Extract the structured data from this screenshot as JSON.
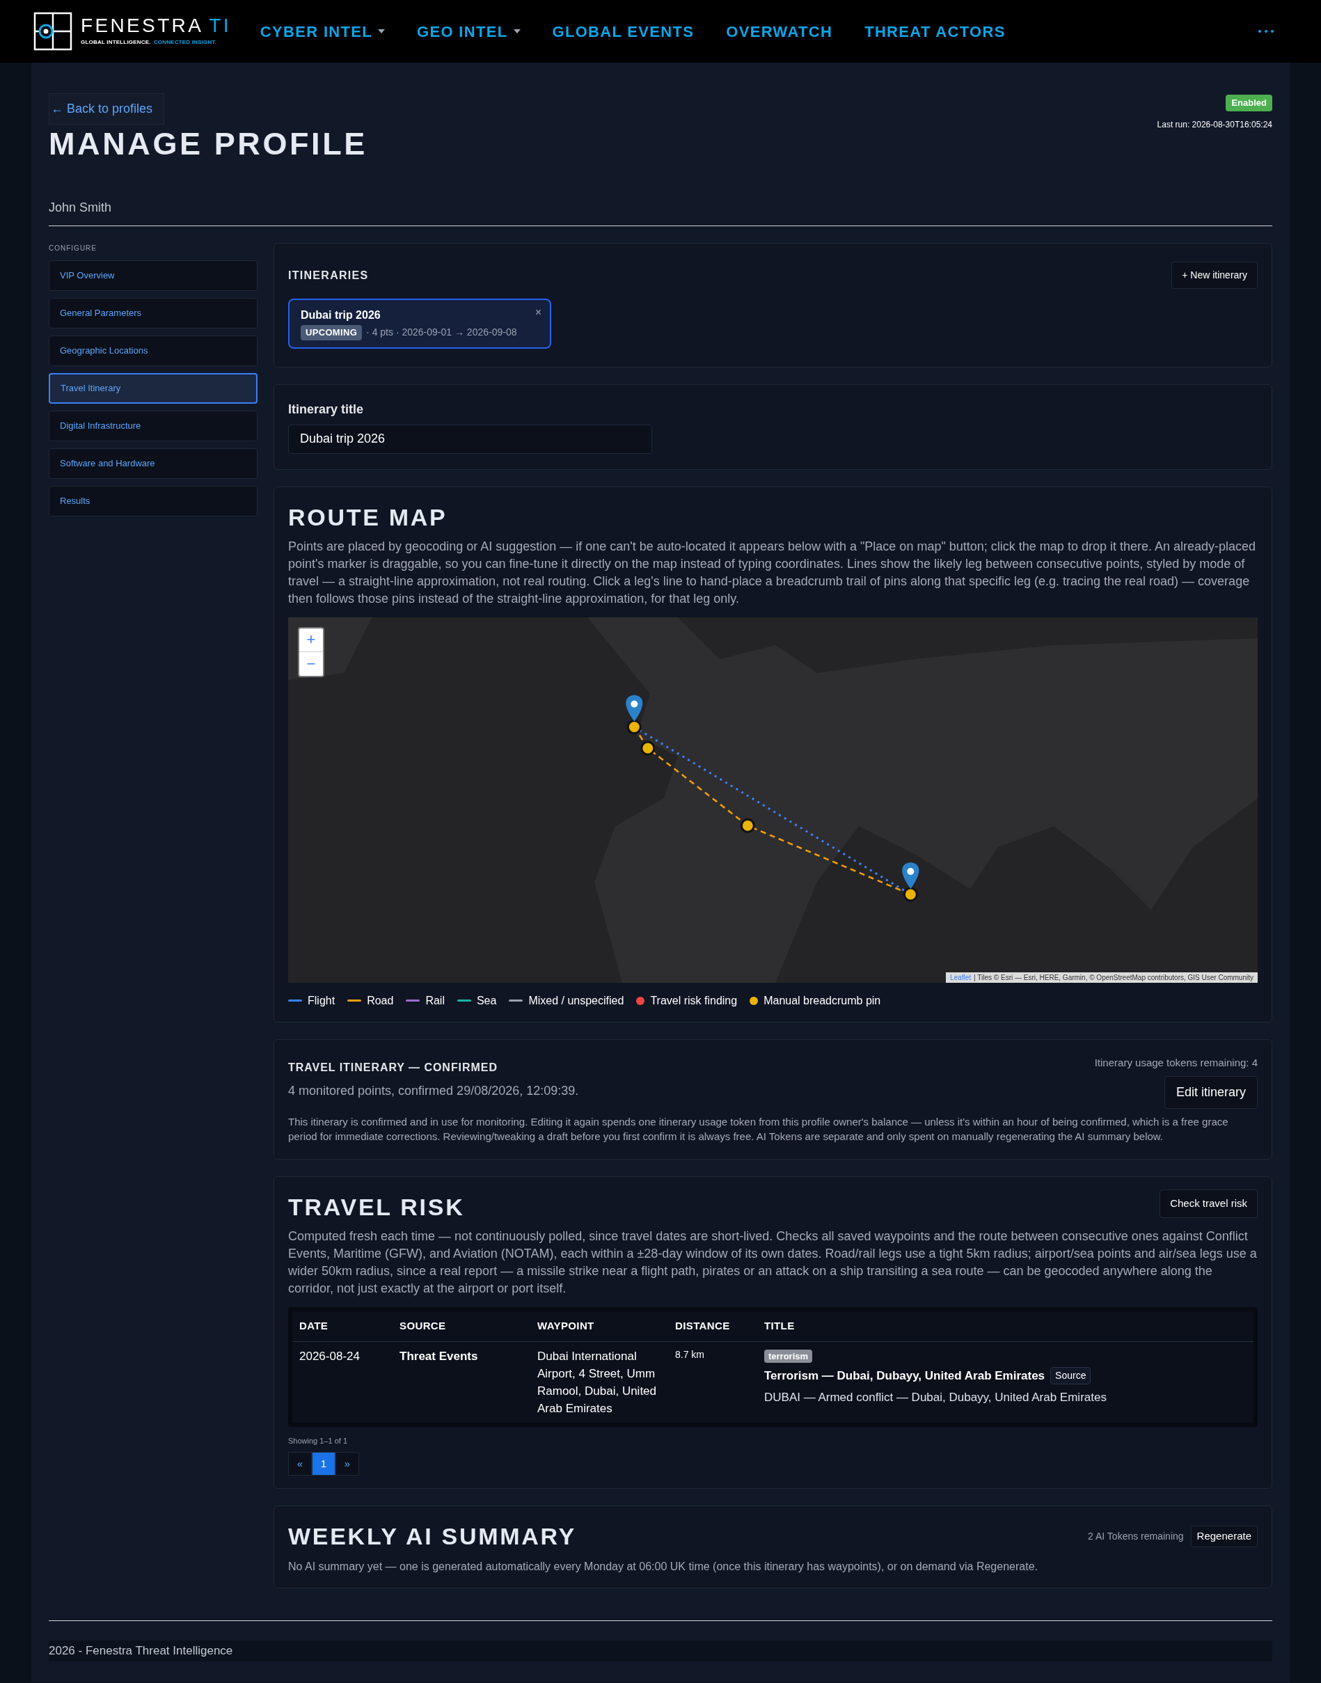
{
  "header": {
    "logo_title": "FENESTRA",
    "logo_accent": "TI",
    "logo_tagline": "GLOBAL INTELLIGENCE.",
    "logo_tagline_accent": "CONNECTED INSIGHT.",
    "nav": [
      {
        "label": "CYBER INTEL",
        "dropdown": true
      },
      {
        "label": "GEO INTEL",
        "dropdown": true
      },
      {
        "label": "GLOBAL EVENTS",
        "dropdown": false
      },
      {
        "label": "OVERWATCH",
        "dropdown": false
      },
      {
        "label": "THREAT ACTORS",
        "dropdown": false
      }
    ]
  },
  "page": {
    "back_link": "← Back to profiles",
    "title": "MANAGE PROFILE",
    "status_badge": "Enabled",
    "last_run": "Last run: 2026-08-30T16:05:24",
    "profile_name": "John Smith"
  },
  "sidebar": {
    "heading": "CONFIGURE",
    "items": [
      {
        "label": "VIP Overview",
        "selected": false
      },
      {
        "label": "General Parameters",
        "selected": false
      },
      {
        "label": "Geographic Locations",
        "selected": false
      },
      {
        "label": "Travel Itinerary",
        "selected": true
      },
      {
        "label": "Digital Infrastructure",
        "selected": false
      },
      {
        "label": "Software and Hardware",
        "selected": false
      },
      {
        "label": "Results",
        "selected": false
      }
    ]
  },
  "itineraries": {
    "heading": "ITINERARIES",
    "new_button": "+ New itinerary",
    "items": [
      {
        "title": "Dubai trip 2026",
        "status": "UPCOMING",
        "meta": "· 4 pts · 2026-09-01 → 2026-09-08",
        "close": "×",
        "selected": true
      }
    ]
  },
  "title_field": {
    "label": "Itinerary title",
    "value": "Dubai trip 2026"
  },
  "route_map": {
    "heading": "ROUTE MAP",
    "description": "Points are placed by geocoding or AI suggestion — if one can't be auto-located it appears below with a \"Place on map\" button; click the map to drop it there. An already-placed point's marker is draggable, so you can fine-tune it directly on the map instead of typing coordinates. Lines show the likely leg between consecutive points, styled by mode of travel — a straight-line approximation, not real routing. Click a leg's line to hand-place a breadcrumb trail of pins along that specific leg (e.g. tracing the real road) — coverage then follows those pins instead of the straight-line approximation, for that leg only.",
    "zoom_in": "+",
    "zoom_out": "−",
    "attribution_link": "Leaflet",
    "attribution": "| Tiles © Esri — Esri, HERE, Garmin, © OpenStreetMap contributors, GIS User Community",
    "legend": [
      {
        "kind": "line",
        "label": "Flight",
        "color": "#3b82f6"
      },
      {
        "kind": "line",
        "label": "Road",
        "color": "#f59e0b"
      },
      {
        "kind": "line",
        "label": "Rail",
        "color": "#a06cd5"
      },
      {
        "kind": "line",
        "label": "Sea",
        "color": "#14b8a6"
      },
      {
        "kind": "line",
        "label": "Mixed / unspecified",
        "color": "#9ca3af"
      },
      {
        "kind": "dot",
        "label": "Travel risk finding",
        "color": "#ef4444"
      },
      {
        "kind": "dot",
        "label": "Manual breadcrumb pin",
        "color": "#eab308"
      }
    ]
  },
  "confirmed": {
    "heading": "TRAVEL ITINERARY — CONFIRMED",
    "summary": "4 monitored points, confirmed 29/08/2026, 12:09:39.",
    "tokens": "Itinerary usage tokens remaining: 4",
    "edit_button": "Edit itinerary",
    "note": "This itinerary is confirmed and in use for monitoring. Editing it again spends one itinerary usage token from this profile owner's balance — unless it's within an hour of being confirmed, which is a free grace period for immediate corrections. Reviewing/tweaking a draft before you first confirm it is always free. AI Tokens are separate and only spent on manually regenerating the AI summary below."
  },
  "travel_risk": {
    "heading": "TRAVEL RISK",
    "check_button": "Check travel risk",
    "description": "Computed fresh each time — not continuously polled, since travel dates are short-lived. Checks all saved waypoints and the route between consecutive ones against Conflict Events, Maritime (GFW), and Aviation (NOTAM), each within a ±28-day window of its own dates. Road/rail legs use a tight 5km radius; airport/sea points and air/sea legs use a wider 50km radius, since a real report — a missile strike near a flight path, pirates or an attack on a ship transiting a sea route — can be geocoded anywhere along the corridor, not just exactly at the airport or port itself.",
    "table": {
      "columns": [
        "DATE",
        "SOURCE",
        "WAYPOINT",
        "DISTANCE",
        "TITLE"
      ],
      "rows": [
        {
          "date": "2026-08-24",
          "source": "Threat Events",
          "waypoint": "Dubai International Airport, 4 Street, Umm Ramool, Dubai, United Arab Emirates",
          "distance": "8.7 km",
          "tag": "terrorism",
          "title": "Terrorism — Dubai, Dubayy, United Arab Emirates",
          "source_button": "Source",
          "detail": "DUBAI — Armed conflict — Dubai, Dubayy, United Arab Emirates"
        }
      ]
    },
    "showing": "Showing 1–1 of 1",
    "pagination": [
      {
        "label": "«",
        "selected": false
      },
      {
        "label": "1",
        "selected": true
      },
      {
        "label": "»",
        "selected": false
      }
    ]
  },
  "weekly_summary": {
    "heading": "WEEKLY AI SUMMARY",
    "tokens": "2 AI Tokens remaining",
    "regenerate_button": "Regenerate",
    "text": "No AI summary yet — one is generated automatically every Monday at 06:00 UK time (once this itinerary has waypoints), or on demand via Regenerate."
  },
  "footer": {
    "text": "2026 - Fenestra Threat Intelligence"
  }
}
